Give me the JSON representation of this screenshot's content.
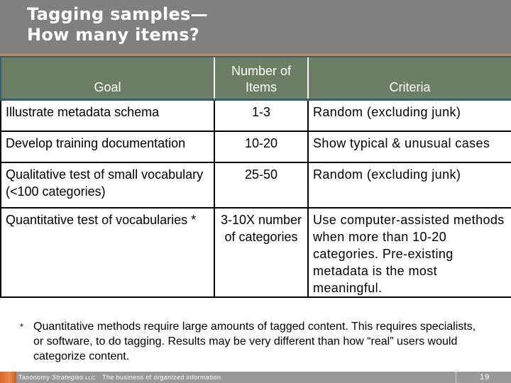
{
  "slide": {
    "title_line1": "Tagging samples—",
    "title_line2": "How many items?"
  },
  "table": {
    "headers": [
      "Goal",
      "Number of Items",
      "Criteria"
    ],
    "header_number_line1": "Number of",
    "header_number_line2": "Items",
    "rows": [
      {
        "goal": "Illustrate metadata schema",
        "items": "1-3",
        "criteria": "Random (excluding junk)"
      },
      {
        "goal": "Develop training documentation",
        "items": "10-20",
        "criteria": "Show typical & unusual cases"
      },
      {
        "goal": "Qualitative test of small vocabulary (<100 categories)",
        "items": "25-50",
        "criteria": "Random (excluding junk)"
      },
      {
        "goal": "Quantitative test of vocabularies *",
        "items": "3-10X number of categories",
        "criteria": "Use computer-assisted methods when more than 10-20 categories. Pre-existing metadata is the most meaningful."
      }
    ]
  },
  "footnote": {
    "marker": "*",
    "text": "Quantitative methods require large amounts of tagged content. This requires specialists, or software, to do tagging. Results may be very different than how “real” users would categorize content."
  },
  "footer": {
    "brand_plain": "Taxonomy ",
    "brand_italic": "Strategies",
    "brand_suffix": " LLC",
    "tagline": "The business of organized information",
    "page_number": "19"
  },
  "colors": {
    "title_band": "#808080",
    "header_fill": "#6c7e64",
    "accent_orange": "#c48a5a",
    "accent_teal": "#2f6170",
    "footer_bar": "#999999"
  }
}
